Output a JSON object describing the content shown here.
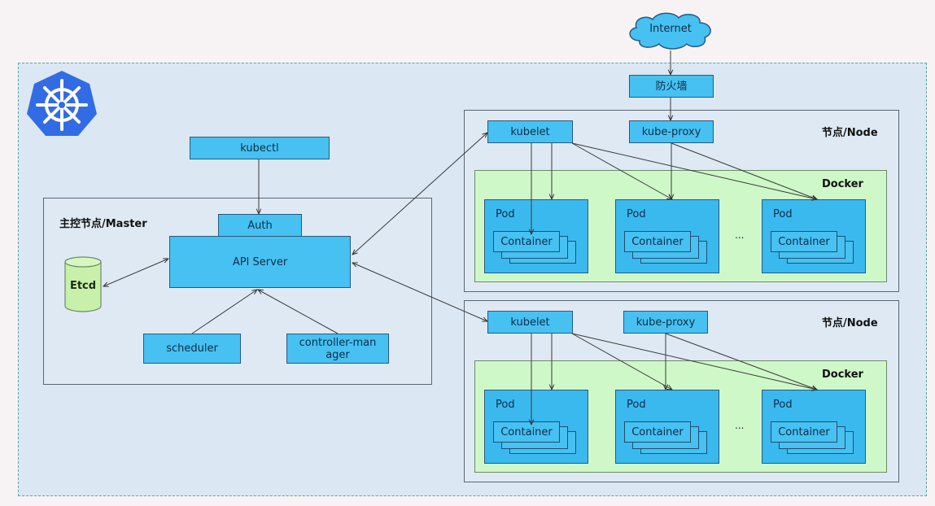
{
  "internet": {
    "label": "Internet"
  },
  "firewall": {
    "label": "防火墙"
  },
  "master": {
    "title": "主控节点/Master",
    "kubectl": "kubectl",
    "auth": "Auth",
    "api_server": "API Server",
    "etcd": "Etcd",
    "scheduler": "scheduler",
    "controller_manager": "controller-manager"
  },
  "nodes": [
    {
      "title": "节点/Node",
      "kubelet": "kubelet",
      "kube_proxy": "kube-proxy",
      "docker": "Docker",
      "pods": [
        {
          "label": "Pod",
          "container": "Container"
        },
        {
          "label": "Pod",
          "container": "Container"
        },
        {
          "label": "Pod",
          "container": "Container"
        }
      ],
      "ellipsis": "..."
    },
    {
      "title": "节点/Node",
      "kubelet": "kubelet",
      "kube_proxy": "kube-proxy",
      "docker": "Docker",
      "pods": [
        {
          "label": "Pod",
          "container": "Container"
        },
        {
          "label": "Pod",
          "container": "Container"
        },
        {
          "label": "Pod",
          "container": "Container"
        }
      ],
      "ellipsis": "..."
    }
  ],
  "colors": {
    "component_fill": "#46c1f1",
    "docker_fill": "#cff8c8",
    "etcd_fill": "#c8f0a8",
    "kubernetes_blue": "#326ce5"
  }
}
